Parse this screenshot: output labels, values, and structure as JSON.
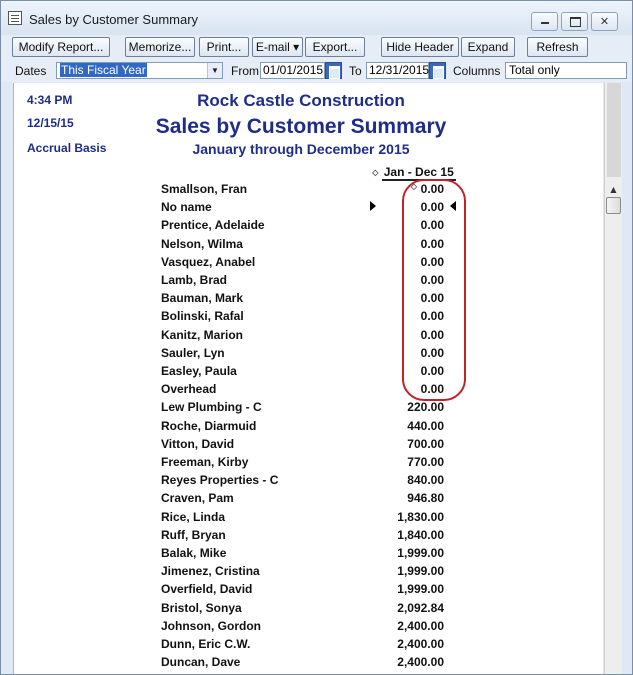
{
  "window": {
    "title": "Sales by Customer Summary"
  },
  "toolbar": {
    "modify_report": "Modify Report...",
    "memorize": "Memorize...",
    "print": "Print...",
    "email": "E-mail ▾",
    "export": "Export...",
    "hide_header": "Hide Header",
    "expand": "Expand",
    "refresh": "Refresh"
  },
  "filters": {
    "dates_label": "Dates",
    "dates_value": "This Fiscal Year",
    "from_label": "From",
    "from_value": "01/01/2015",
    "to_label": "To",
    "to_value": "12/31/2015",
    "columns_label": "Columns",
    "columns_value": "Total only"
  },
  "report": {
    "time": "4:34 PM",
    "date": "12/15/15",
    "basis": "Accrual Basis",
    "company": "Rock Castle Construction",
    "title": "Sales by Customer Summary",
    "range": "January through December 2015",
    "column_header": "Jan - Dec 15",
    "rows": [
      {
        "name": "Smallson, Fran",
        "amount": "0.00"
      },
      {
        "name": "No name",
        "amount": "0.00"
      },
      {
        "name": "Prentice, Adelaide",
        "amount": "0.00"
      },
      {
        "name": "Nelson, Wilma",
        "amount": "0.00"
      },
      {
        "name": "Vasquez, Anabel",
        "amount": "0.00"
      },
      {
        "name": "Lamb, Brad",
        "amount": "0.00"
      },
      {
        "name": "Bauman, Mark",
        "amount": "0.00"
      },
      {
        "name": "Bolinski, Rafal",
        "amount": "0.00"
      },
      {
        "name": "Kanitz, Marion",
        "amount": "0.00"
      },
      {
        "name": "Sauler, Lyn",
        "amount": "0.00"
      },
      {
        "name": "Easley, Paula",
        "amount": "0.00"
      },
      {
        "name": "Overhead",
        "amount": "0.00"
      },
      {
        "name": "Lew Plumbing - C",
        "amount": "220.00"
      },
      {
        "name": "Roche, Diarmuid",
        "amount": "440.00"
      },
      {
        "name": "Vitton, David",
        "amount": "700.00"
      },
      {
        "name": "Freeman, Kirby",
        "amount": "770.00"
      },
      {
        "name": "Reyes Properties - C",
        "amount": "840.00"
      },
      {
        "name": "Craven, Pam",
        "amount": "946.80"
      },
      {
        "name": "Rice, Linda",
        "amount": "1,830.00"
      },
      {
        "name": "Ruff, Bryan",
        "amount": "1,840.00"
      },
      {
        "name": "Balak, Mike",
        "amount": "1,999.00"
      },
      {
        "name": "Jimenez, Cristina",
        "amount": "1,999.00"
      },
      {
        "name": "Overfield, David",
        "amount": "1,999.00"
      },
      {
        "name": "Bristol, Sonya",
        "amount": "2,092.84"
      },
      {
        "name": "Johnson, Gordon",
        "amount": "2,400.00"
      },
      {
        "name": "Dunn, Eric C.W.",
        "amount": "2,400.00"
      },
      {
        "name": "Duncan, Dave",
        "amount": "2,400.00"
      }
    ]
  },
  "colors": {
    "report_blue": "#1f2d8a",
    "highlight_circle": "#c0232b",
    "selection": "#3168c5"
  }
}
